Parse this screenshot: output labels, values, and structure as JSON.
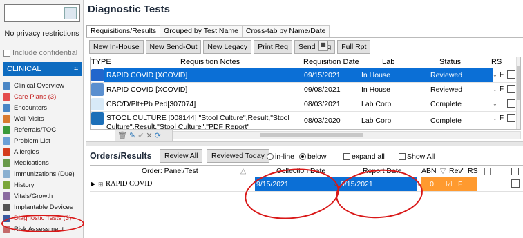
{
  "sidebar": {
    "privacy": "No privacy restrictions",
    "include_confidential": "Include confidential",
    "section": "CLINICAL",
    "section_chevron": "≈",
    "items": [
      {
        "label": "Clinical Overview",
        "color": "#4a86c5"
      },
      {
        "label": "Care Plans (3)",
        "color": "#e44c4c"
      },
      {
        "label": "Encounters",
        "color": "#4a86c5"
      },
      {
        "label": "Well Visits",
        "color": "#d97a2f"
      },
      {
        "label": "Referrals/TOC",
        "color": "#3a9a3a"
      },
      {
        "label": "Problem List",
        "color": "#6aa0d6"
      },
      {
        "label": "Allergies",
        "color": "#d43c1c"
      },
      {
        "label": "Medications",
        "color": "#6a9a4a"
      },
      {
        "label": "Immunizations (Due)",
        "color": "#8ab0d0"
      },
      {
        "label": "History",
        "color": "#7aa63a"
      },
      {
        "label": "Vitals/Growth",
        "color": "#8a6aa0"
      },
      {
        "label": "Implantable Devices",
        "color": "#555555"
      },
      {
        "label": "Diagnostic Tests (3)",
        "color": "#3a5aa0"
      },
      {
        "label": "Risk Assessment",
        "color": "#c46a6a"
      }
    ]
  },
  "page": {
    "title": "Diagnostic Tests"
  },
  "tabs": [
    "Requisitions/Results",
    "Grouped by Test Name",
    "Cross-tab by Name/Date"
  ],
  "toolbar": [
    "New In-House",
    "New Send-Out",
    "New Legacy",
    "Print Req",
    "Send Msg",
    "Full Rpt"
  ],
  "grid": {
    "headers": {
      "type": "TYPE",
      "notes": "Requisition Notes",
      "date": "Requisition Date",
      "lab": "Lab",
      "status": "Status",
      "rs": "RS"
    },
    "rows": [
      {
        "notes": "RAPID COVID [XCOVID]",
        "date": "09/15/2021",
        "lab": "In House",
        "status": "Reviewed",
        "rs": "F",
        "icon_color": "#2266cc"
      },
      {
        "notes": "RAPID COVID [XCOVID]",
        "date": "09/08/2021",
        "lab": "In House",
        "status": "Reviewed",
        "rs": "F",
        "icon_color": "#5a8fcf"
      },
      {
        "notes": "CBC/D/Plt+Pb Ped[307074]",
        "date": "08/03/2021",
        "lab": "Lab Corp",
        "status": "Complete",
        "rs": "",
        "icon_color": "#d8eaf8"
      },
      {
        "notes": "STOOL CULTURE [008144] \"Stool Culture\",Result,\"Stool Culture\",Result,\"Stool Culture\",\"PDF Report\"",
        "date": "08/03/2020",
        "lab": "Lab Corp",
        "status": "Complete",
        "rs": "F",
        "icon_color": "#1c6fb8"
      },
      {
        "notes": "",
        "date": "",
        "lab": "",
        "status": "",
        "rs": "",
        "icon_color": "#f3d0d0"
      }
    ]
  },
  "actions": {
    "delete": "🗑",
    "edit": "✎",
    "confirm": "✔",
    "cancel": "✕",
    "refresh": "⟳"
  },
  "orders": {
    "title": "Orders/Results",
    "review_all": "Review All",
    "reviewed_today": "Reviewed Today",
    "inline": "in-line",
    "below": "below",
    "expand_all": "expand all",
    "show_all": "Show All",
    "headers": {
      "panel": "Order: Panel/Test",
      "collection": "Collection Date",
      "report": "Report Date",
      "abn": "ABN",
      "rev": "Rev'",
      "rs": "RS"
    },
    "row": {
      "name": "RAPID COVID",
      "collection": "9/15/2021",
      "report": "9/15/2021",
      "abn": "0",
      "reviewed": "☑",
      "rs": "F"
    }
  }
}
